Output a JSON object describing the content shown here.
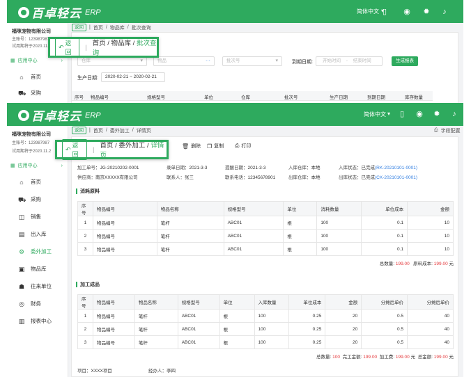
{
  "brand": {
    "name": "百卓轻云",
    "suffix": "ERP",
    "color": "#2eaa5e"
  },
  "header": {
    "lang": "简体中文",
    "icons": [
      "mobile-icon",
      "broadcast-icon",
      "gear-icon",
      "bell-icon"
    ]
  },
  "account": {
    "company": "福咪宠物有限公司",
    "id_back": "主账号：123987987",
    "id_front": "主账号：123987987",
    "expire_back": "试用期将于2020.11.2",
    "expire_front": "试用期将于2020.11.2"
  },
  "sidebar": {
    "head": "应用中心",
    "items": [
      "首页",
      "采购",
      "销售",
      "出入库",
      "委外加工",
      "物品库",
      "往来单位",
      "财务",
      "报表中心"
    ],
    "active_index": 4
  },
  "screen1": {
    "back": "返回",
    "crumb": [
      "首页",
      "物品库",
      "批次查询"
    ],
    "filters": {
      "warehouse": "仓库",
      "item": "物品",
      "batch": "批次号",
      "expire_label": "到期日期:",
      "start": "开始时间",
      "to": "-",
      "end": "结束时间",
      "generate": "生成报表",
      "prod_label": "生产日期:",
      "prod_range": "2020-02-21  ~  2020-02-21"
    },
    "columns": [
      "序号",
      "物品编号",
      "规格型号",
      "单位",
      "仓库",
      "批次号",
      "生产日期",
      "到期日期",
      "库存数量"
    ]
  },
  "callout1": {
    "back": "返回",
    "crumb": [
      "首页",
      "物品库",
      "批次查询"
    ]
  },
  "screen2": {
    "back": "返回",
    "crumb": [
      "首页",
      "委外加工",
      "详情页"
    ],
    "field_config": "字段配置",
    "toolbar": [
      "删除",
      "复制",
      "打印"
    ],
    "info_row1": [
      {
        "k": "加工单号：",
        "v": "JG-20210202-0001"
      },
      {
        "k": "录单日期：",
        "v": "2021-3-3"
      },
      {
        "k": "提醒日期：",
        "v": "2021-3-3"
      },
      {
        "k": "入库仓库：",
        "v": "本地"
      },
      {
        "k": "入库状态：",
        "v": "已完成",
        "link": "(RK-20210101-0001)"
      }
    ],
    "info_row2": [
      {
        "k": "供应商：",
        "v": "南京XXXXX有限公司"
      },
      {
        "k": "联系人：",
        "v": "张三"
      },
      {
        "k": "联系电话：",
        "v": "12345678901"
      },
      {
        "k": "出库仓库：",
        "v": "本地"
      },
      {
        "k": "出库状态：",
        "v": "已完成",
        "link": "(CK-20210101-0001)"
      }
    ],
    "section1": "消耗原料",
    "table1": {
      "columns": [
        "序号",
        "物品编号",
        "物品名称",
        "规格型号",
        "单位",
        "消耗数量",
        "单位成本",
        "金额"
      ],
      "rows": [
        [
          "1",
          "物品编号",
          "笔杆",
          "ABC01",
          "根",
          "100",
          "0.1",
          "10"
        ],
        [
          "2",
          "物品编号",
          "笔杆",
          "ABC01",
          "根",
          "100",
          "0.1",
          "10"
        ],
        [
          "3",
          "物品编号",
          "笔杆",
          "ABC01",
          "根",
          "100",
          "0.1",
          "10"
        ]
      ],
      "sum": {
        "qty_label": "总数量:",
        "qty": "199.00",
        "cost_label": "原料成本:",
        "cost": "199.00",
        "unit": "元"
      }
    },
    "section2": "加工成品",
    "table2": {
      "columns": [
        "序号",
        "物品编号",
        "物品名称",
        "规格型号",
        "单位",
        "入库数量",
        "单位成本",
        "金额",
        "分摊后单价",
        "分摊后单价"
      ],
      "rows": [
        [
          "1",
          "物品编号",
          "笔杆",
          "ABC01",
          "根",
          "100",
          "0.25",
          "20",
          "0.5",
          "40"
        ],
        [
          "2",
          "物品编号",
          "笔杆",
          "ABC01",
          "根",
          "100",
          "0.25",
          "20",
          "0.5",
          "40"
        ],
        [
          "3",
          "物品编号",
          "笔杆",
          "ABC01",
          "根",
          "100",
          "0.25",
          "20",
          "0.5",
          "40"
        ]
      ],
      "sum": {
        "qty_label": "总数量:",
        "qty": "100",
        "done_label": "完工金额:",
        "done": "199.00",
        "fee_label": "加工费:",
        "fee": "199.00",
        "fee_unit": "元",
        "total_label": "总金额:",
        "total": "199.00",
        "unit": "元"
      }
    },
    "footer": {
      "project_label": "项目：",
      "project": "XXXX项目",
      "handler_label": "经办人：",
      "handler": "李四"
    }
  },
  "callout2": {
    "back": "返回",
    "crumb": [
      "首页",
      "委外加工",
      "详情页"
    ]
  }
}
